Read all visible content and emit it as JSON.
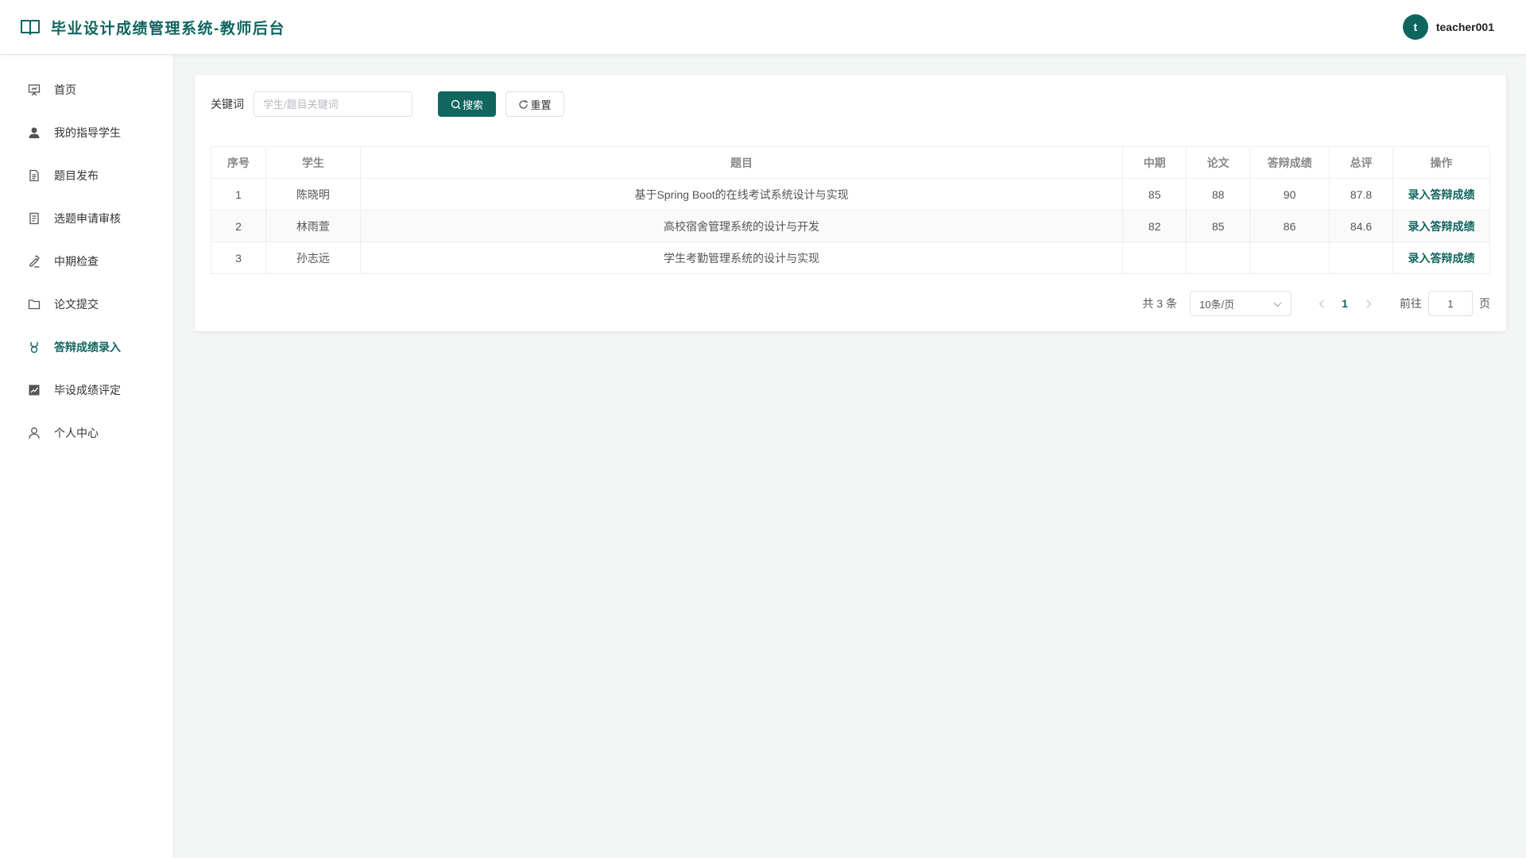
{
  "header": {
    "title": "毕业设计成绩管理系统-教师后台",
    "user": {
      "avatar_letter": "t",
      "username": "teacher001"
    }
  },
  "sidebar": {
    "items": [
      {
        "label": "首页",
        "icon": "presentation-icon",
        "active": false
      },
      {
        "label": "我的指导学生",
        "icon": "user-icon",
        "active": false
      },
      {
        "label": "题目发布",
        "icon": "document-icon",
        "active": false
      },
      {
        "label": "选题申请审核",
        "icon": "document-list-icon",
        "active": false
      },
      {
        "label": "中期检查",
        "icon": "edit-pen-icon",
        "active": false
      },
      {
        "label": "论文提交",
        "icon": "folder-icon",
        "active": false
      },
      {
        "label": "答辩成绩录入",
        "icon": "medal-icon",
        "active": true
      },
      {
        "label": "毕设成绩评定",
        "icon": "chart-icon",
        "active": false
      },
      {
        "label": "个人中心",
        "icon": "user-outline-icon",
        "active": false
      }
    ]
  },
  "search": {
    "label": "关键词",
    "placeholder": "学生/题目关键词",
    "value": "",
    "search_button": "搜索",
    "reset_button": "重置"
  },
  "table": {
    "columns": [
      "序号",
      "学生",
      "题目",
      "中期",
      "论文",
      "答辩成绩",
      "总评",
      "操作"
    ],
    "rows": [
      {
        "index": "1",
        "student": "陈晓明",
        "topic": "基于Spring Boot的在线考试系统设计与实现",
        "midterm": "85",
        "thesis": "88",
        "defense": "90",
        "total": "87.8",
        "action": "录入答辩成绩"
      },
      {
        "index": "2",
        "student": "林雨萱",
        "topic": "高校宿舍管理系统的设计与开发",
        "midterm": "82",
        "thesis": "85",
        "defense": "86",
        "total": "84.6",
        "action": "录入答辩成绩"
      },
      {
        "index": "3",
        "student": "孙志远",
        "topic": "学生考勤管理系统的设计与实现",
        "midterm": "",
        "thesis": "",
        "defense": "",
        "total": "",
        "action": "录入答辩成绩"
      }
    ]
  },
  "pagination": {
    "total_text": "共 3 条",
    "page_size": "10条/页",
    "current_page": "1",
    "goto_label": "前往",
    "goto_value": "1",
    "page_suffix": "页"
  },
  "colors": {
    "accent": "#10655f",
    "background": "#f4f5f5"
  }
}
